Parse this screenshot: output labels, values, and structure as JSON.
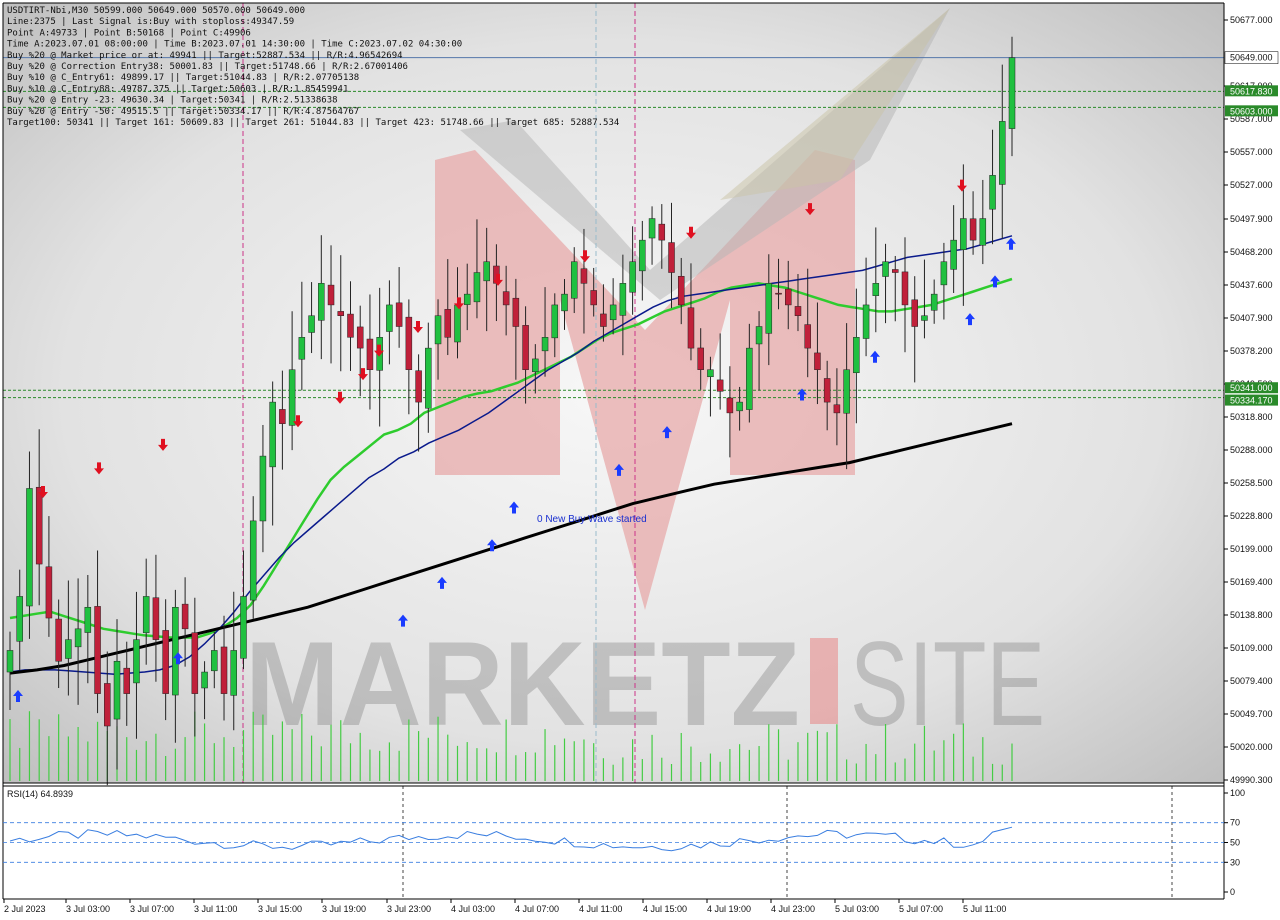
{
  "header": {
    "info_lines": [
      "USDTIRT-Nbi,M30  50599.000 50649.000 50570.000 50649.000",
      "Line:2375 | Last Signal is:Buy with stoploss:49347.59",
      "Point A:49733 | Point B:50168 | Point C:49906",
      "Time A:2023.07.01 08:00:00 | Time B:2023.07.01 14:30:00 | Time C:2023.07.02 04:30:00",
      "Buy %20 @ Market price or at: 49941 || Target:52887.534 || R/R:4.96542694",
      "Buy %20 @ Correction Entry38: 50001.83 || Target:51748.66 | R/R:2.67001406",
      "Buy %10 @ C_Entry61: 49899.17 || Target:51044.83 | R/R:2.07705138",
      "Buy %10 @ C_Entry88: 49787.375 || Target:50603 | R/R:1.85459941",
      "Buy %20 @ Entry -23: 49630.34 | Target:50341 | R/R:2.5133863​8",
      "Buy %20 @ Entry -50: 49515.5 || Target:50334.17 || R/R:4.87564767",
      "Target100: 50341 || Target 161: 50609.83 || Target 261: 51044.83 || Target 423: 51748.66 || Target 685: 52887.534"
    ]
  },
  "annotation": "0 New Buy Wave started",
  "watermark": "MARKETZ|SITE",
  "price_axis": {
    "ticks": [
      "50677.000",
      "50617.000",
      "50587.000",
      "50557.000",
      "50527.000",
      "50497.900",
      "50468.200",
      "50437.600",
      "50407.900",
      "50378.200",
      "50349.500",
      "50318.800",
      "50288.000",
      "50258.500",
      "50228.800",
      "50199.000",
      "50169.400",
      "50138.800",
      "50109.000",
      "50079.400",
      "50049.700",
      "50020.000",
      "49990.300"
    ],
    "current_price_label": "50649.000",
    "level_labels": [
      "50617.830",
      "50603.000",
      "50341.000",
      "50334.170"
    ]
  },
  "time_axis": {
    "labels": [
      "2 Jul 2023",
      "3 Jul 03:00",
      "3 Jul 07:00",
      "3 Jul 11:00",
      "3 Jul 15:00",
      "3 Jul 19:00",
      "3 Jul 23:00",
      "4 Jul 03:00",
      "4 Jul 07:00",
      "4 Jul 11:00",
      "4 Jul 15:00",
      "4 Jul 19:00",
      "4 Jul 23:00",
      "5 Jul 03:00",
      "5 Jul 07:00",
      "5 Jul 11:00"
    ]
  },
  "rsi": {
    "label": "RSI(14) 64.8939",
    "ticks": [
      "100",
      "70",
      "50",
      "30",
      "0"
    ]
  },
  "colors": {
    "bull": "#20c040",
    "bear": "#c0203a",
    "ma_fast": "#2ecc2e",
    "ma_mid": "#0a1a8c",
    "ma_slow": "#000000",
    "level_line": "#2a8a2a",
    "rsi_line": "#3a7ee0",
    "buy_arrow": "#1a3cff",
    "sell_arrow": "#e01020"
  },
  "chart_data": {
    "type": "candlestick",
    "symbol": "USDTIRT-Nbi",
    "timeframe": "M30",
    "ylim": [
      49980,
      50695
    ],
    "x_start": "2023-07-02 13:30",
    "x_end": "2023-07-05 13:30",
    "close_approx": [
      50100,
      50150,
      50250,
      50180,
      50130,
      50090,
      50110,
      50120,
      50140,
      50060,
      50030,
      50090,
      50060,
      50110,
      50150,
      50110,
      50060,
      50140,
      50120,
      50060,
      50080,
      50100,
      50060,
      50100,
      50150,
      50220,
      50280,
      50330,
      50310,
      50360,
      50390,
      50410,
      50440,
      50420,
      50410,
      50390,
      50380,
      50360,
      50390,
      50420,
      50400,
      50360,
      50330,
      50380,
      50410,
      50390,
      50420,
      50430,
      50450,
      50460,
      50440,
      50420,
      50400,
      50360,
      50370,
      50390,
      50420,
      50430,
      50460,
      50440,
      50420,
      50400,
      50420,
      50440,
      50460,
      50480,
      50500,
      50480,
      50450,
      50420,
      50380,
      50360,
      50360,
      50340,
      50320,
      50330,
      50380,
      50400,
      50440,
      50430,
      50420,
      50410,
      50380,
      50360,
      50330,
      50320,
      50360,
      50390,
      50420,
      50440,
      50460,
      50450,
      50420,
      50400,
      50410,
      50430,
      50460,
      50480,
      50500,
      50480,
      50500,
      50540,
      50590,
      50649
    ],
    "moving_averages": [
      {
        "color": "#2ecc2e",
        "values_approx": [
          50130,
          50132,
          50134,
          50136,
          50132,
          50128,
          50124,
          50120,
          50118,
          50116,
          50114,
          50113,
          50112,
          50112,
          50112,
          50116,
          50122,
          50130,
          50142,
          50160,
          50180,
          50200,
          50220,
          50240,
          50258,
          50270,
          50280,
          50290,
          50300,
          50304,
          50310,
          50320,
          50325,
          50330,
          50335,
          50338,
          50340,
          50344,
          50348,
          50354,
          50360,
          50366,
          50372,
          50380,
          50388,
          50394,
          50398,
          50402,
          50408,
          50414,
          50418,
          50422,
          50426,
          50432,
          50436,
          50438,
          50440,
          50438,
          50436,
          50432,
          50428,
          50424,
          50420,
          50418,
          50416,
          50414,
          50414,
          50416,
          50418,
          50420,
          50424,
          50428,
          50432,
          50436,
          50440,
          50444
        ]
      },
      {
        "color": "#0a1a8c",
        "values_approx": [
          50080,
          50082,
          50082,
          50082,
          50081,
          50080,
          50079,
          50078,
          50079,
          50080,
          50082,
          50086,
          50094,
          50106,
          50120,
          50136,
          50154,
          50170,
          50186,
          50200,
          50212,
          50224,
          50236,
          50248,
          50260,
          50268,
          50278,
          50284,
          50292,
          50298,
          50304,
          50312,
          50320,
          50330,
          50340,
          50350,
          50360,
          50368,
          50376,
          50386,
          50394,
          50402,
          50410,
          50418,
          50424,
          50428,
          50430,
          50432,
          50434,
          50436,
          50438,
          50440,
          50442,
          50444,
          50446,
          50448,
          50450,
          50452,
          50456,
          50460,
          50464,
          50466,
          50468,
          50470,
          50472,
          50476,
          50480,
          50484
        ]
      },
      {
        "color": "#000000",
        "values_approx": [
          50079,
          50082,
          50086,
          50092,
          50098,
          50104,
          50110,
          50116,
          50122,
          50128,
          50134,
          50140,
          50148,
          50156,
          50164,
          50172,
          50180,
          50188,
          50196,
          50204,
          50212,
          50220,
          50228,
          50236,
          50242,
          50248,
          50254,
          50258,
          50262,
          50266,
          50270,
          50274,
          50280,
          50286,
          50292,
          50298,
          50304,
          50310
        ]
      }
    ],
    "levels": [
      50617.83,
      50603.0,
      50341.0,
      50334.17
    ],
    "rsi_last": 64.8939
  }
}
